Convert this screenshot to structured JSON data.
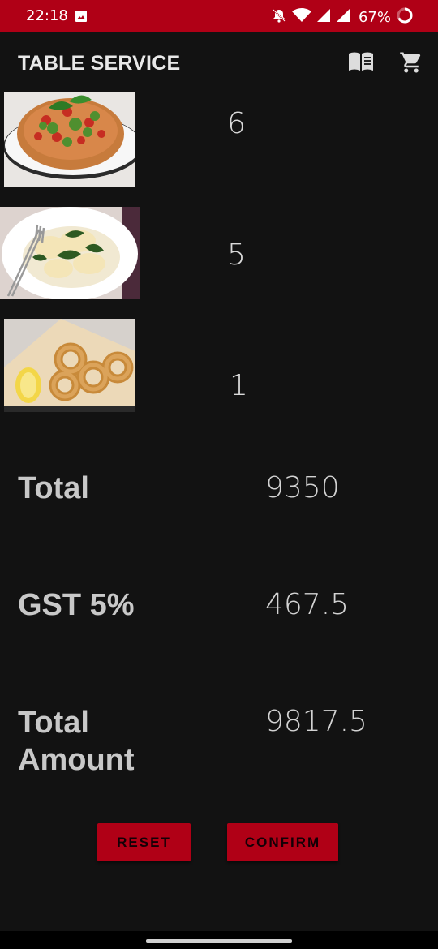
{
  "status_bar": {
    "time": "22:18",
    "battery_text": "67%",
    "icons": [
      "photo-icon",
      "mute-icon",
      "wifi-icon",
      "signal-icon",
      "signal-icon",
      "battery-ring-icon"
    ]
  },
  "app_bar": {
    "title": "TABLE SERVICE",
    "icons": [
      "menu-book-icon",
      "cart-icon"
    ]
  },
  "cart_items": [
    {
      "image": "bruschetta-pizza",
      "quantity": "6"
    },
    {
      "image": "ravioli-spinach",
      "quantity": "5"
    },
    {
      "image": "fried-calamari",
      "quantity": "1"
    }
  ],
  "summary": {
    "total_label": "Total",
    "total_value": "9350",
    "gst_label": "GST 5%",
    "gst_value": "467.5",
    "total_amount_label_line1": "Total",
    "total_amount_label_line2": "Amount",
    "total_amount_value": "9817.5"
  },
  "buttons": {
    "reset": "RESET",
    "confirm": "CONFIRM"
  },
  "colors": {
    "accent": "#b00016",
    "background": "#121212"
  }
}
